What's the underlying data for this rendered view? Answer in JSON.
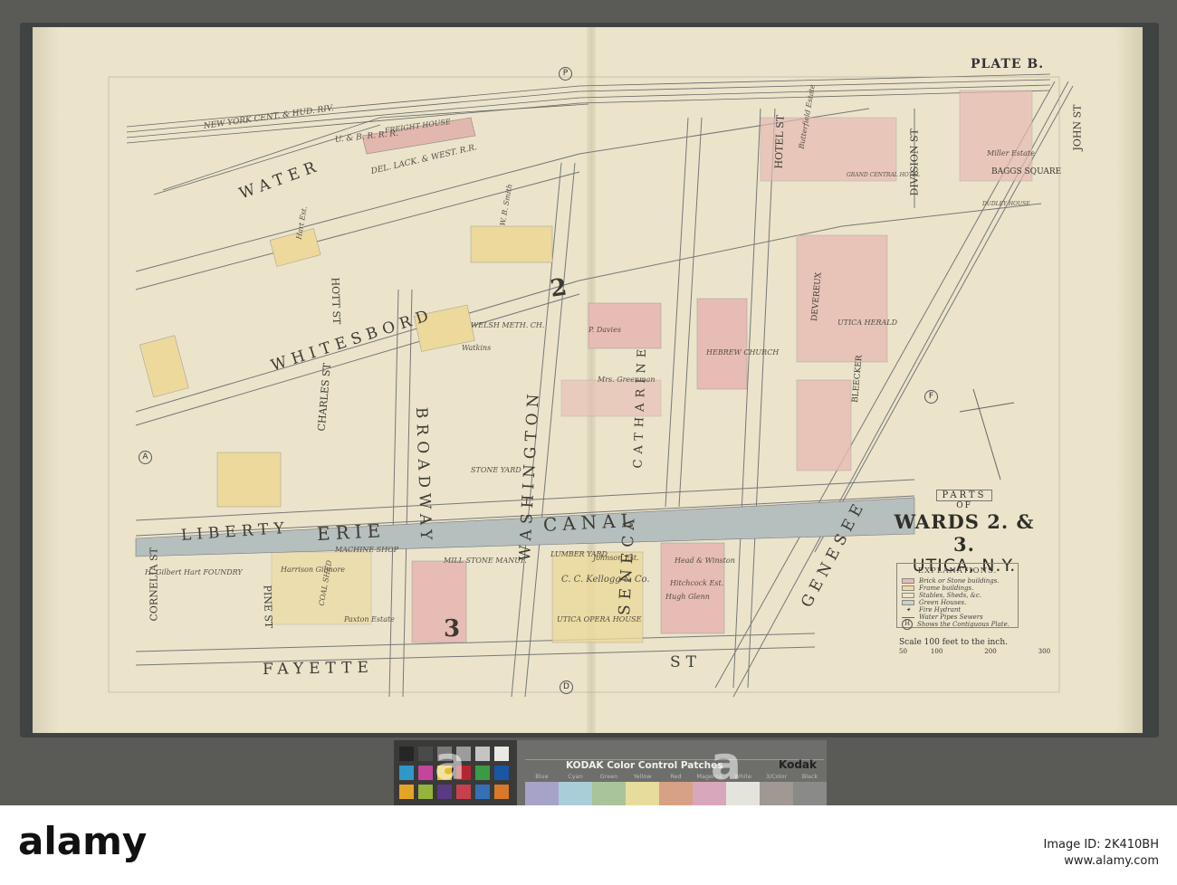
{
  "plate": "PLATE B.",
  "title": {
    "parts": "PARTS",
    "of": "OF",
    "wards": "WARDS 2. & 3.",
    "city": "UTICA, N.Y."
  },
  "legend": {
    "heading": "EXPLANATIONS.",
    "items": [
      "Brick or Stone buildings.",
      "Frame buildings.",
      "Stables, Sheds, &c.",
      "Green Houses.",
      "Fire Hydrant",
      "Water Pipes   Sewers",
      "Shows the Contiguous Plate."
    ],
    "colors": [
      "#e9b9b5",
      "#eddc9c",
      "#ece5cb",
      "#c8d2c0"
    ]
  },
  "scale": {
    "label": "Scale 100 feet to the inch.",
    "ticks": [
      "50",
      "100",
      "200",
      "300"
    ]
  },
  "streets": [
    "WATER",
    "WHITESBORD",
    "LIBERTY",
    "FAYETTE",
    "ST",
    "BROADWAY",
    "WASHINGTON",
    "SENECA",
    "GENESEE",
    "DIVISION ST",
    "JOHN ST",
    "HOTEL ST",
    "CHARLES ST",
    "HOTT ST",
    "PINE ST",
    "CORNELIA ST",
    "BAGGS SQUARE",
    "CATHARINE",
    "ERIE",
    "CANAL",
    "BLEECKER",
    "DEVEREUX"
  ],
  "railroads": [
    "U. & B. R. R. R.",
    "NEW YORK CENT. & HUD. RIV.",
    "DEL. LACK. & WEST. R.R.",
    "FREIGHT HOUSE"
  ],
  "places": [
    "UTICA HERALD",
    "UTICA OPERA HOUSE",
    "GRAND CENTRAL HOTEL",
    "DUDLEY HOUSE",
    "LUMBER YARD",
    "MACHINE SHOP",
    "MILL STONE MANUF.",
    "C. C. Kellogg & Co.",
    "Harrison Gilmore",
    "Paxton Estate",
    "STONE YARD",
    "WELSH METH. CH.",
    "HEBREW CHURCH",
    "COAL SHED",
    "Hugh Glenn",
    "Head & Winston",
    "Hitchcock Est.",
    "Miller Estate",
    "Butterfield Estate",
    "Hart Est.",
    "P. Davies",
    "Mrs. Greenman",
    "Watkins",
    "W. B. Smith",
    "H. Gilbert Hart FOUNDRY",
    "Johnson Est."
  ],
  "sheet_markers": [
    "P",
    "A",
    "F",
    "D"
  ],
  "ward_numbers": [
    "2",
    "3"
  ],
  "kodak": {
    "title": "KODAK Color Control Patches",
    "logo": "Kodak",
    "names": [
      "Blue",
      "Cyan",
      "Green",
      "Yellow",
      "Red",
      "Magenta",
      "White",
      "3/Color",
      "Black"
    ],
    "bar_colors": [
      "#a7a3c8",
      "#a9cdd9",
      "#a9c49a",
      "#e8dc9c",
      "#d6a184",
      "#d9a7bb",
      "#e4e4dc",
      "#9f9893",
      "#8a8a88"
    ],
    "patch_colors": [
      "#262626",
      "#4a4a4a",
      "#7a7a7a",
      "#9c9c9c",
      "#c4c4c4",
      "#e8e8e4",
      "#2e98c9",
      "#c4469a",
      "#e4be2c",
      "#b62630",
      "#3c9a44",
      "#1b55a6",
      "#e4a424",
      "#94b43c",
      "#5a3a84",
      "#c8404c",
      "#3270b8",
      "#d8782a"
    ]
  },
  "watermark": {
    "logo": "alamy",
    "image_id": "Image ID: 2K410BH",
    "url": "www.alamy.com"
  }
}
